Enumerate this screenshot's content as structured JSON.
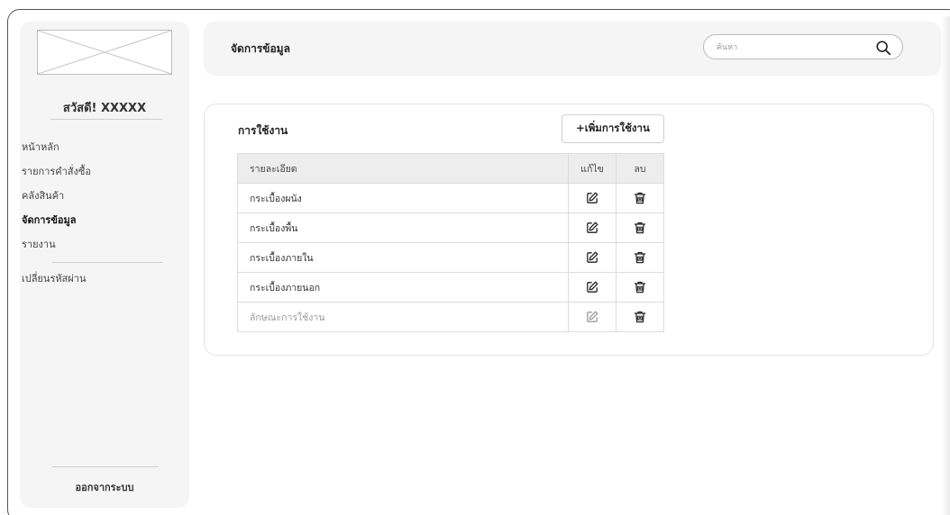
{
  "sidebar": {
    "greeting": "สวัสดี! XXXXX",
    "nav": [
      {
        "label": "หน้าหลัก",
        "active": false
      },
      {
        "label": "รายการคำสั่งซื้อ",
        "active": false
      },
      {
        "label": "คลังสินค้า",
        "active": false
      },
      {
        "label": "จัดการข้อมูล",
        "active": true
      },
      {
        "label": "รายงาน",
        "active": false
      }
    ],
    "change_password": "เปลี่ยนรหัสผ่าน",
    "logout": "ออกจากระบบ"
  },
  "header": {
    "title": "จัดการข้อมูล",
    "search_placeholder": "ค้นหา"
  },
  "card": {
    "title": "การใช้งาน",
    "add_button": "+เพิ่มการใช้งาน",
    "columns": {
      "description": "รายละเอียด",
      "edit": "แก้ไข",
      "delete": "ลบ"
    },
    "rows": [
      {
        "label": "กระเบื้องผนัง"
      },
      {
        "label": "กระเบื้องพื้น"
      },
      {
        "label": "กระเบื้องภายใน"
      },
      {
        "label": "กระเบื้องภายนอก"
      },
      {
        "label": "ลักษณะการใช้งาน"
      }
    ]
  },
  "icons": {
    "search": "search-icon",
    "edit": "edit-icon",
    "delete": "trash-icon"
  }
}
